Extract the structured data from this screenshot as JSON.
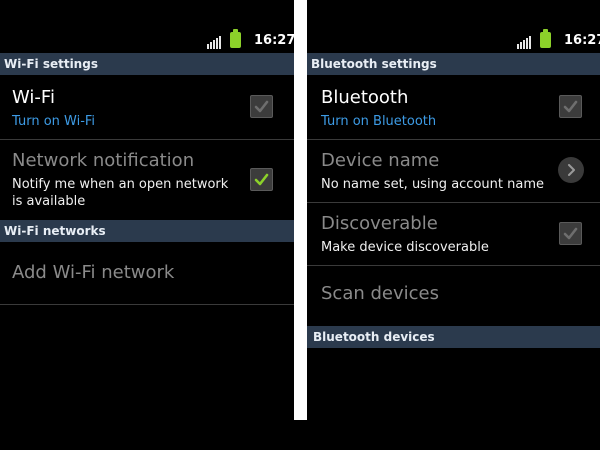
{
  "status_bar": {
    "time": "16:27"
  },
  "wifi_screen": {
    "header": "Wi-Fi settings",
    "wifi": {
      "title": "Wi-Fi",
      "subtitle": "Turn on Wi-Fi",
      "checked": false
    },
    "network_notification": {
      "title": "Network notification",
      "subtitle_line1": "Notify me when an open network",
      "subtitle_line2": "is available",
      "checked": true
    },
    "networks_header": "Wi-Fi networks",
    "add_network": {
      "title": "Add Wi-Fi network"
    }
  },
  "bluetooth_screen": {
    "header": "Bluetooth settings",
    "bluetooth": {
      "title": "Bluetooth",
      "subtitle": "Turn on Bluetooth",
      "checked": false
    },
    "device_name": {
      "title": "Device name",
      "subtitle": "No name set, using account name"
    },
    "discoverable": {
      "title": "Discoverable",
      "subtitle": "Make device discoverable",
      "checked": false
    },
    "scan_devices": {
      "title": "Scan devices"
    },
    "devices_header": "Bluetooth devices"
  },
  "colors": {
    "header_bar": "#2b3a4d",
    "link_blue": "#3d9be5",
    "check_green": "#8cd12a",
    "battery_green": "#8cd12a"
  },
  "icons": [
    "signal-icon",
    "battery-icon",
    "checkbox-icon",
    "chevron-right-icon"
  ]
}
